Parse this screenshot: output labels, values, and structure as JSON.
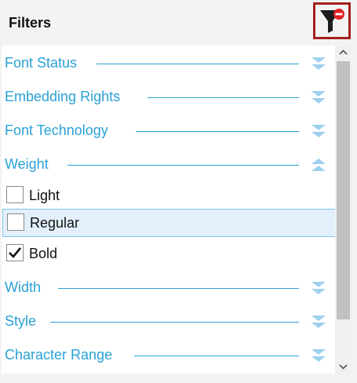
{
  "header": {
    "title": "Filters",
    "clear_filter_icon": "filter-remove-icon"
  },
  "colors": {
    "accent": "#2aa1d6",
    "chevron": "#9fd1ee",
    "clear_button_border": "#a31f1f",
    "remove_badge": "#e02020",
    "highlight_bg": "#e3f0fb",
    "highlight_border": "#7cc6ec"
  },
  "sections": [
    {
      "label": "Font Status",
      "expanded": false
    },
    {
      "label": "Embedding Rights",
      "expanded": false
    },
    {
      "label": "Font Technology",
      "expanded": false
    },
    {
      "label": "Weight",
      "expanded": true,
      "options": [
        {
          "label": "Light",
          "checked": false,
          "highlighted": false
        },
        {
          "label": "Regular",
          "checked": false,
          "highlighted": true
        },
        {
          "label": "Bold",
          "checked": true,
          "highlighted": false
        }
      ]
    },
    {
      "label": "Width",
      "expanded": false
    },
    {
      "label": "Style",
      "expanded": false
    },
    {
      "label": "Character Range",
      "expanded": false
    }
  ]
}
